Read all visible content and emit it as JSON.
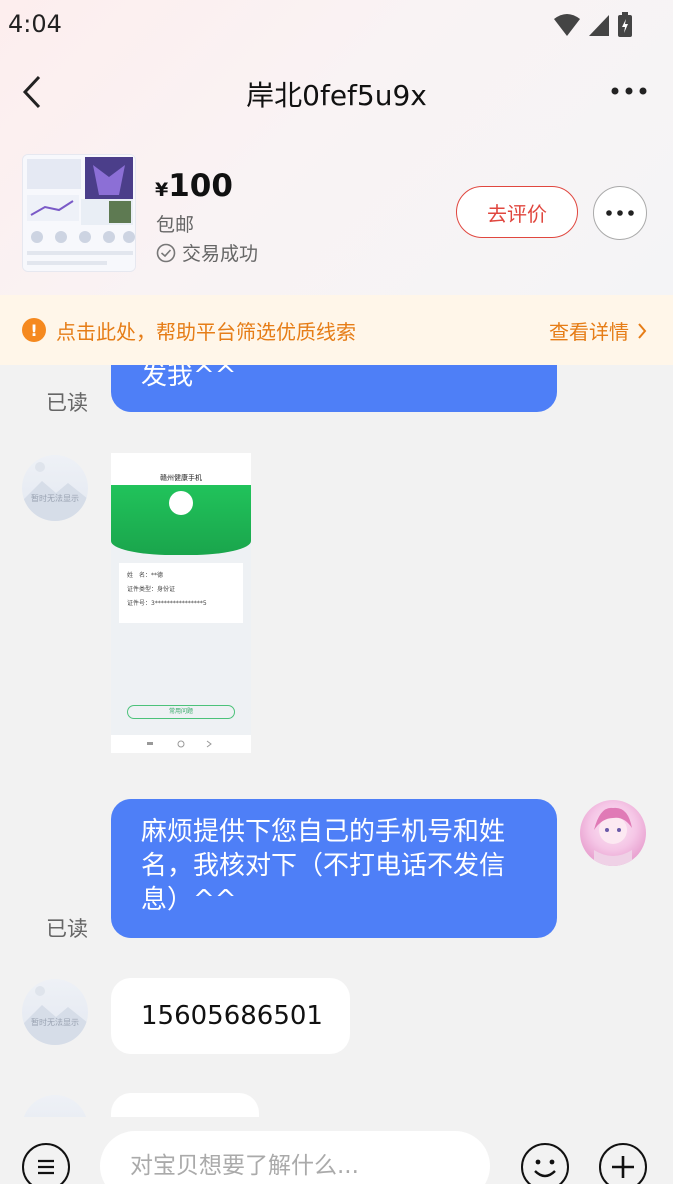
{
  "status_bar": {
    "time": "4:04"
  },
  "nav": {
    "title": "岸北0fef5u9x"
  },
  "product": {
    "currency": "¥",
    "price": "100",
    "shipping": "包邮",
    "status": "交易成功",
    "review_label": "去评价"
  },
  "banner": {
    "icon": "!",
    "text": "点击此处，帮助平台筛选优质线索",
    "link_label": "查看详情"
  },
  "messages": [
    {
      "side": "out",
      "text": "发我^^",
      "read": "已读"
    },
    {
      "side": "in",
      "type": "image",
      "image_texts": {
        "title": "赣州健康手机",
        "field_name_label": "姓　名：",
        "field_name_value": "**德",
        "field_id_type_label": "证件类型：",
        "field_id_type_value": "身份证",
        "field_id_label": "证件号：",
        "field_id_value": "3****************5",
        "button": "常用问题"
      }
    },
    {
      "side": "out",
      "text": "麻烦提供下您自己的手机号和姓名，我核对下（不打电话不发信息）^^",
      "read": "已读"
    },
    {
      "side": "in",
      "text": "15605686501"
    }
  ],
  "avatar_placeholder_text": "暂时无法显示",
  "input": {
    "placeholder": "对宝贝想要了解什么..."
  },
  "colors": {
    "accent_blue": "#4e7ff7",
    "review_red": "#e0473f",
    "banner_orange": "#e67d17",
    "banner_bg": "#fff6e9"
  }
}
